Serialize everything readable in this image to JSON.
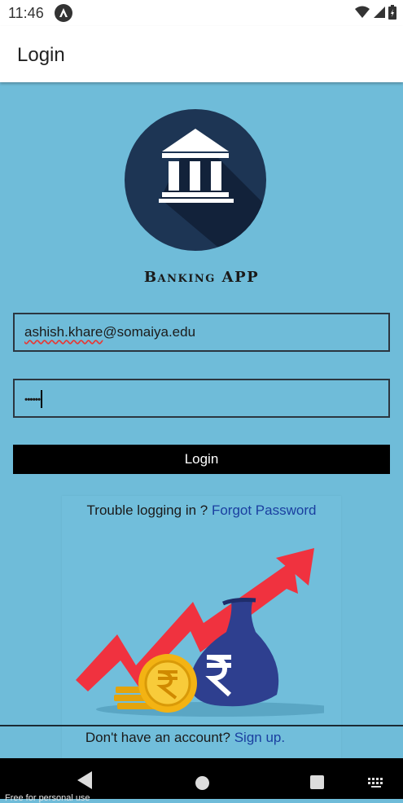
{
  "status_bar": {
    "time": "11:46"
  },
  "app_bar": {
    "title": "Login"
  },
  "brand": {
    "name": "Banking APP"
  },
  "login_form": {
    "email_value_part1": "ashish.khare",
    "email_value_part2": "@somaiya.edu",
    "password_mask": "••••••",
    "login_label": "Login"
  },
  "help": {
    "trouble_text": "Trouble logging in ? ",
    "forgot_link": "Forgot Password",
    "signup_text": "Don't have an account? ",
    "signup_link": "Sign up."
  },
  "footer": {
    "note": "Free for personal use"
  },
  "colors": {
    "background": "#6fbcd9",
    "logo_bg": "#1d3554",
    "button": "#000000",
    "link": "#1a3fa0",
    "arrow": "#f0323f",
    "bag": "#2e3f8f",
    "coin": "#f3b313"
  },
  "icons": [
    "app-notification-icon",
    "wifi-icon",
    "cellular-signal-icon",
    "battery-icon",
    "bank-building-icon",
    "money-growth-illustration",
    "back-icon",
    "home-icon",
    "recents-icon",
    "keyboard-icon"
  ]
}
